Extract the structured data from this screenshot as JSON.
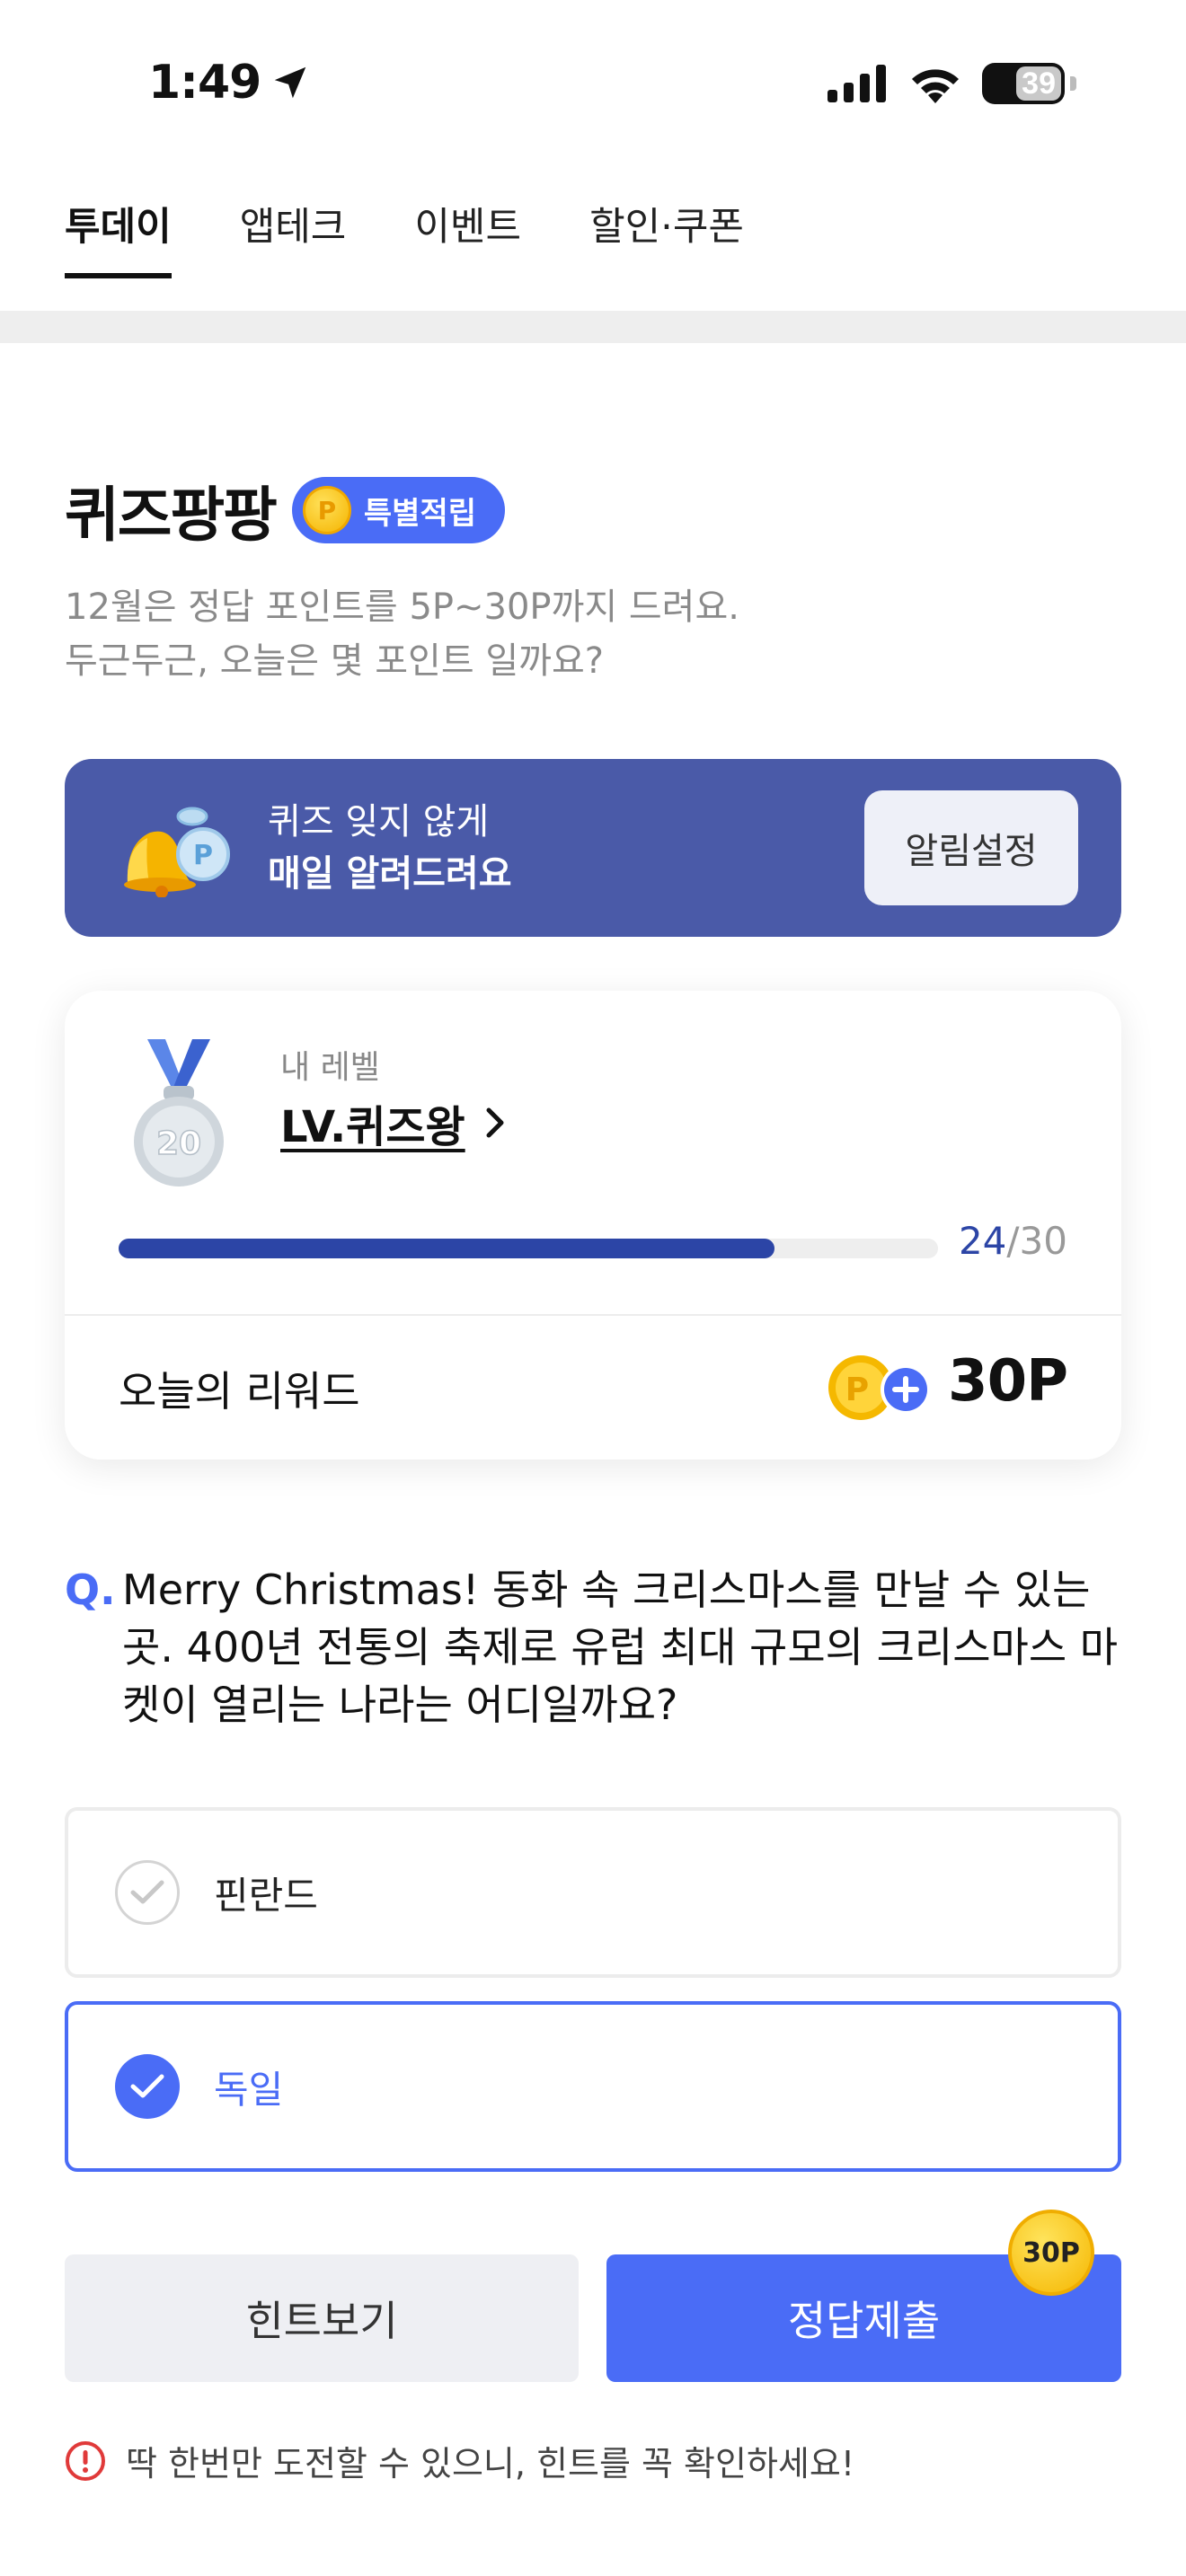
{
  "status": {
    "time": "1:49",
    "battery": "39"
  },
  "tabs": [
    {
      "label": "투데이",
      "active": true
    },
    {
      "label": "앱테크",
      "active": false
    },
    {
      "label": "이벤트",
      "active": false
    },
    {
      "label": "할인·쿠폰",
      "active": false
    }
  ],
  "header": {
    "title": "퀴즈팡팡",
    "badge": "특별적립",
    "badge_coin": "P",
    "subtitle_line1": "12월은 정답 포인트를 5P~30P까지 드려요.",
    "subtitle_line2": "두근두근, 오늘은 몇 포인트 일까요?"
  },
  "alarm": {
    "line1": "퀴즈 잊지 않게",
    "line2": "매일 알려드려요",
    "button": "알림설정"
  },
  "level": {
    "label": "내 레벨",
    "name": "LV.퀴즈왕",
    "medal_number": "20",
    "progress_current": "24",
    "progress_total": "/30",
    "progress_fraction": 0.8
  },
  "reward": {
    "label": "오늘의 리워드",
    "value": "30P"
  },
  "question": {
    "mark": "Q.",
    "text": "Merry Christmas! 동화 속 크리스마스를 만날 수 있는 곳. 400년 전통의 축제로 유럽 최대 규모의 크리스마스 마켓이 열리는 나라는 어디일까요?"
  },
  "options": [
    {
      "label": "핀란드",
      "selected": false
    },
    {
      "label": "독일",
      "selected": true
    }
  ],
  "buttons": {
    "hint": "힌트보기",
    "submit": "정답제출",
    "submit_badge": "30P"
  },
  "warning": "딱 한번만 도전할 수 있으니, 힌트를 꼭 확인하세요!",
  "colors": {
    "accent": "#4a6cf6",
    "banner": "#4a5aa8",
    "progress": "#2c45a6",
    "warning": "#e03a3a"
  }
}
